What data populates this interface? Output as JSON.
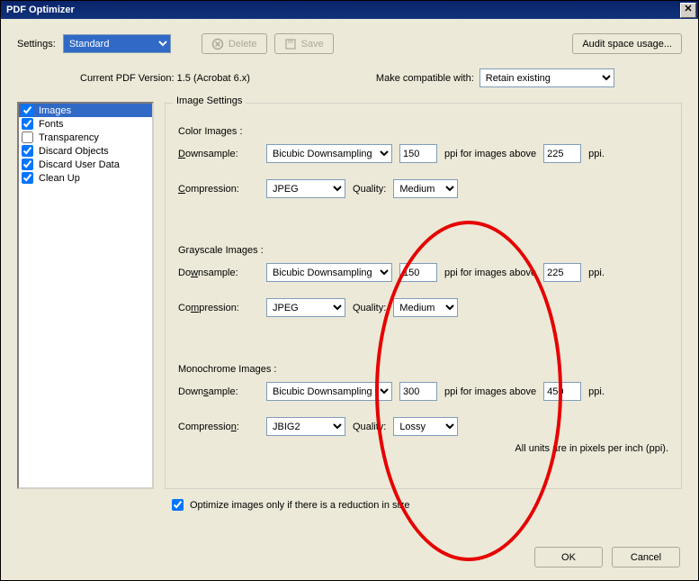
{
  "window": {
    "title": "PDF Optimizer"
  },
  "top": {
    "settings_label": "Settings:",
    "settings_value": "Standard",
    "delete_label": "Delete",
    "save_label": "Save",
    "audit_label": "Audit space usage..."
  },
  "version": {
    "current_label": "Current PDF Version: 1.5 (Acrobat 6.x)",
    "make_label": "Make compatible with:",
    "make_value": "Retain existing"
  },
  "sidebar": {
    "items": [
      {
        "label": "Images",
        "checked": true,
        "selected": true
      },
      {
        "label": "Fonts",
        "checked": true,
        "selected": false
      },
      {
        "label": "Transparency",
        "checked": false,
        "selected": false
      },
      {
        "label": "Discard Objects",
        "checked": true,
        "selected": false
      },
      {
        "label": "Discard User Data",
        "checked": true,
        "selected": false
      },
      {
        "label": "Clean Up",
        "checked": true,
        "selected": false
      }
    ]
  },
  "panel": {
    "legend": "Image Settings",
    "color": {
      "heading": "Color Images :",
      "downsample_label": "Downsample:",
      "downsample_method": "Bicubic Downsampling to",
      "downsample_value": "150",
      "ppi_for_label": "ppi for images above",
      "above_value": "225",
      "ppi_suffix": "ppi.",
      "compression_label": "Compression:",
      "compression_value": "JPEG",
      "quality_label": "Quality:",
      "quality_value": "Medium"
    },
    "gray": {
      "heading": "Grayscale Images :",
      "downsample_label": "Downsample:",
      "downsample_method": "Bicubic Downsampling to",
      "downsample_value": "150",
      "ppi_for_label": "ppi for images above",
      "above_value": "225",
      "ppi_suffix": "ppi.",
      "compression_label": "Compression:",
      "compression_value": "JPEG",
      "quality_label": "Quality:",
      "quality_value": "Medium"
    },
    "mono": {
      "heading": "Monochrome Images :",
      "downsample_label": "Downsample:",
      "downsample_method": "Bicubic Downsampling to",
      "downsample_value": "300",
      "ppi_for_label": "ppi for images above",
      "above_value": "450",
      "ppi_suffix": "ppi.",
      "compression_label": "Compression:",
      "compression_value": "JBIG2",
      "quality_label": "Quality:",
      "quality_value": "Lossy"
    },
    "note": "All units are in pixels per inch (ppi)."
  },
  "optimize": {
    "label": "Optimize images only if there is a reduction in size",
    "checked": true
  },
  "buttons": {
    "ok": "OK",
    "cancel": "Cancel"
  }
}
